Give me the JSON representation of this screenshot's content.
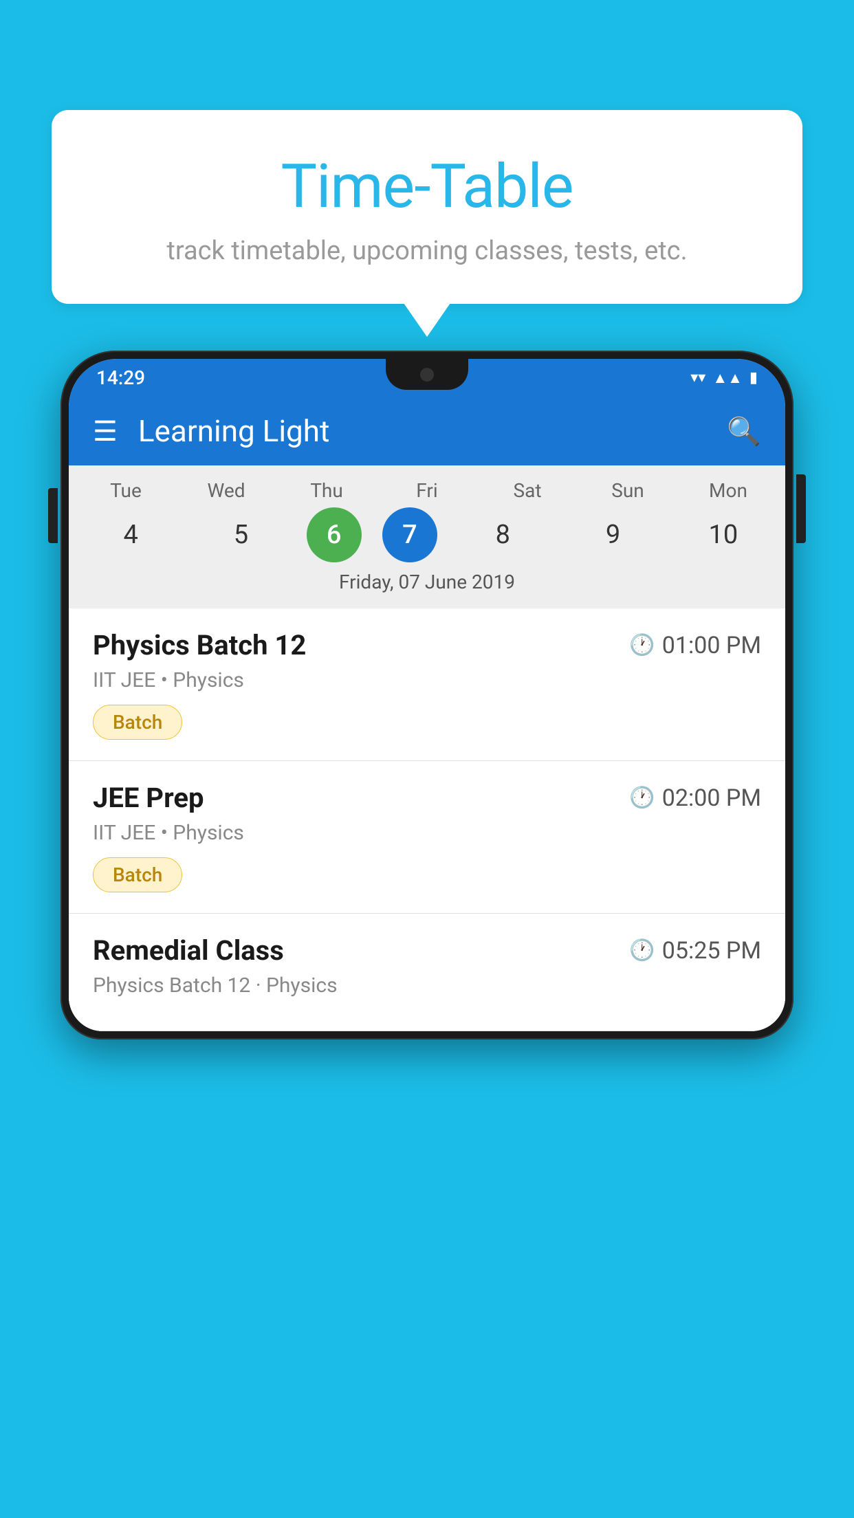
{
  "background": {
    "color": "#1bbde8"
  },
  "speech_bubble": {
    "title": "Time-Table",
    "subtitle": "track timetable, upcoming classes, tests, etc."
  },
  "phone": {
    "status_bar": {
      "time": "14:29"
    },
    "app_bar": {
      "title": "Learning Light"
    },
    "calendar": {
      "days": [
        {
          "label": "Tue",
          "num": "4"
        },
        {
          "label": "Wed",
          "num": "5"
        },
        {
          "label": "Thu",
          "num": "6",
          "state": "today"
        },
        {
          "label": "Fri",
          "num": "7",
          "state": "selected"
        },
        {
          "label": "Sat",
          "num": "8"
        },
        {
          "label": "Sun",
          "num": "9"
        },
        {
          "label": "Mon",
          "num": "10"
        }
      ],
      "selected_date_label": "Friday, 07 June 2019"
    },
    "schedule": [
      {
        "title": "Physics Batch 12",
        "time": "01:00 PM",
        "subtitle": "IIT JEE • Physics",
        "badge": "Batch"
      },
      {
        "title": "JEE Prep",
        "time": "02:00 PM",
        "subtitle": "IIT JEE • Physics",
        "badge": "Batch"
      },
      {
        "title": "Remedial Class",
        "time": "05:25 PM",
        "subtitle": "Physics Batch 12 · Physics",
        "badge": null
      }
    ]
  }
}
